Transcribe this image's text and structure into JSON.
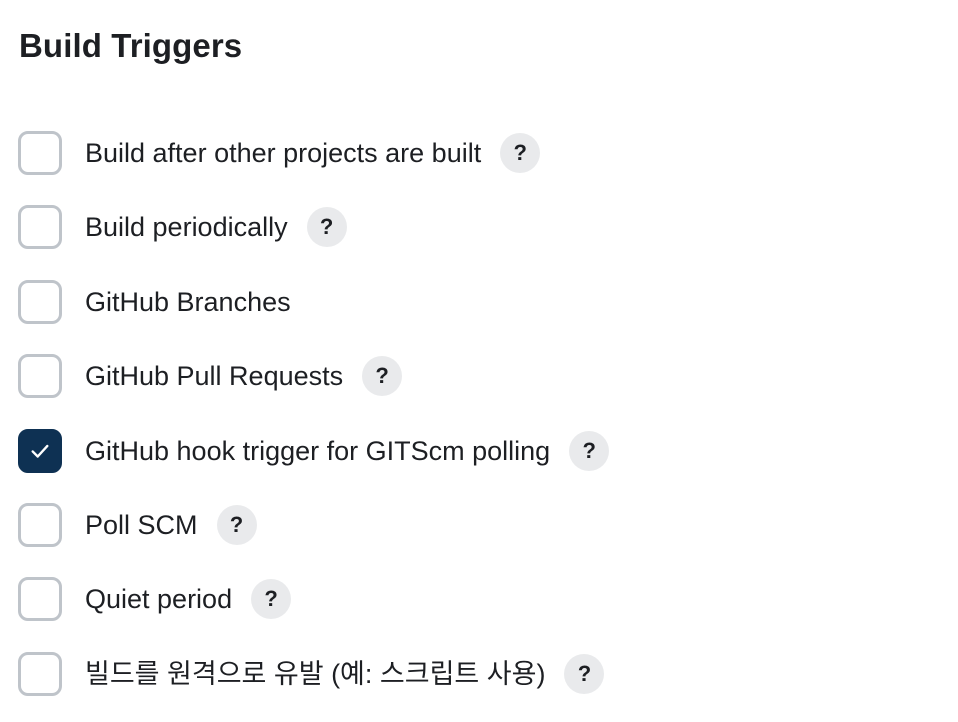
{
  "section": {
    "title": "Build Triggers"
  },
  "help_label": "?",
  "colors": {
    "checked_fill": "#0e3153",
    "checkbox_border": "#bfc4ca",
    "help_bg": "#e9eaec"
  },
  "triggers": [
    {
      "label": "Build after other projects are built",
      "checked": false,
      "has_help": true
    },
    {
      "label": "Build periodically",
      "checked": false,
      "has_help": true
    },
    {
      "label": "GitHub Branches",
      "checked": false,
      "has_help": false
    },
    {
      "label": "GitHub Pull Requests",
      "checked": false,
      "has_help": true
    },
    {
      "label": "GitHub hook trigger for GITScm polling",
      "checked": true,
      "has_help": true
    },
    {
      "label": "Poll SCM",
      "checked": false,
      "has_help": true
    },
    {
      "label": "Quiet period",
      "checked": false,
      "has_help": true
    },
    {
      "label": "빌드를 원격으로 유발 (예: 스크립트 사용)",
      "checked": false,
      "has_help": true
    }
  ]
}
